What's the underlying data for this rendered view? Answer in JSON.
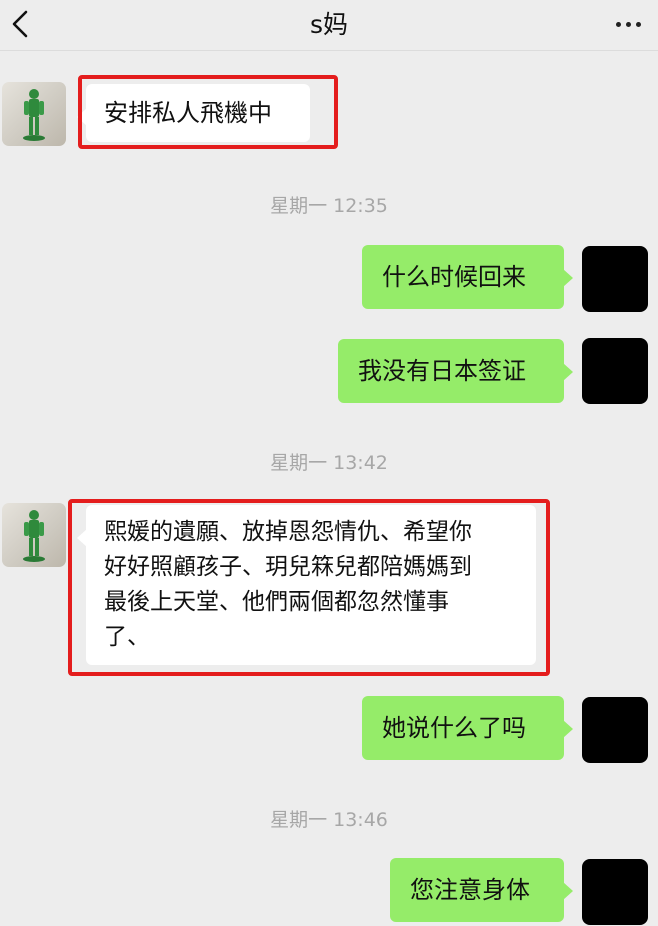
{
  "header": {
    "title": "s妈"
  },
  "messages": [
    {
      "side": "left",
      "text": "安排私人飛機中"
    },
    {
      "side": "right",
      "text": "什么时候回来"
    },
    {
      "side": "right",
      "text": "我没有日本签证"
    },
    {
      "side": "left",
      "lines": [
        "熙媛的遺願、放掉恩怨情仇、希望你",
        "好好照顧孩子、玥兒箖兒都陪媽媽到",
        "最後上天堂、他們兩個都忽然懂事",
        "了、"
      ]
    },
    {
      "side": "right",
      "text": "她说什么了吗"
    },
    {
      "side": "right",
      "text": "您注意身体"
    }
  ],
  "timestamps": [
    "星期一 12:35",
    "星期一 13:42",
    "星期一 13:46"
  ],
  "colors": {
    "bubble_green": "#95ec69",
    "highlight_red": "#e41d1d",
    "background": "#ededed"
  }
}
